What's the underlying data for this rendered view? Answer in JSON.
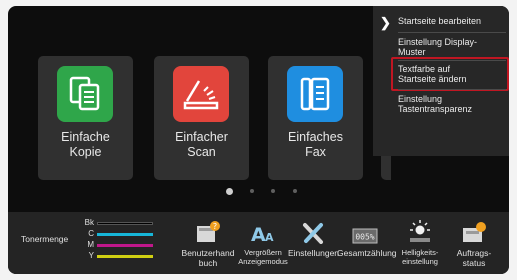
{
  "tiles": [
    {
      "label": "Einfache\nKopie",
      "icon": "copy-icon",
      "color": "#2fa64a"
    },
    {
      "label": "Einfacher\nScan",
      "icon": "scan-icon",
      "color": "#e2453c"
    },
    {
      "label": "Einfaches\nFax",
      "icon": "fax-icon",
      "color": "#1f8ee0"
    }
  ],
  "menu": {
    "items": [
      {
        "label": "Startseite bearbeiten"
      },
      {
        "label": "Einstellung Display-\nMuster"
      },
      {
        "label": "Textfarbe auf\nStartseite ändern"
      },
      {
        "label": "Einstellung\nTastentransparenz"
      }
    ],
    "highlight_color": "#c01622"
  },
  "pagination": {
    "count": 4,
    "active": 1
  },
  "toner": {
    "label": "Tonermenge",
    "levels": [
      {
        "name": "Bk",
        "color": "#000000"
      },
      {
        "name": "C",
        "color": "#17b6d8"
      },
      {
        "name": "M",
        "color": "#c0178a"
      },
      {
        "name": "Y",
        "color": "#cfcf12"
      }
    ]
  },
  "toolbar": [
    {
      "label": "Benutzerhand\nbuch",
      "icon": "manual-icon"
    },
    {
      "label": "Vergrößern\nAnzeigemodus",
      "icon": "enlarge-text-icon"
    },
    {
      "label": "Einstellungen",
      "icon": "settings-tools-icon"
    },
    {
      "label": "Gesamtzählung",
      "icon": "counter-icon"
    },
    {
      "label": "Helligkeits-\neinstellung",
      "icon": "brightness-icon"
    },
    {
      "label": "Auftrags-\nstatus",
      "icon": "job-status-icon"
    }
  ]
}
